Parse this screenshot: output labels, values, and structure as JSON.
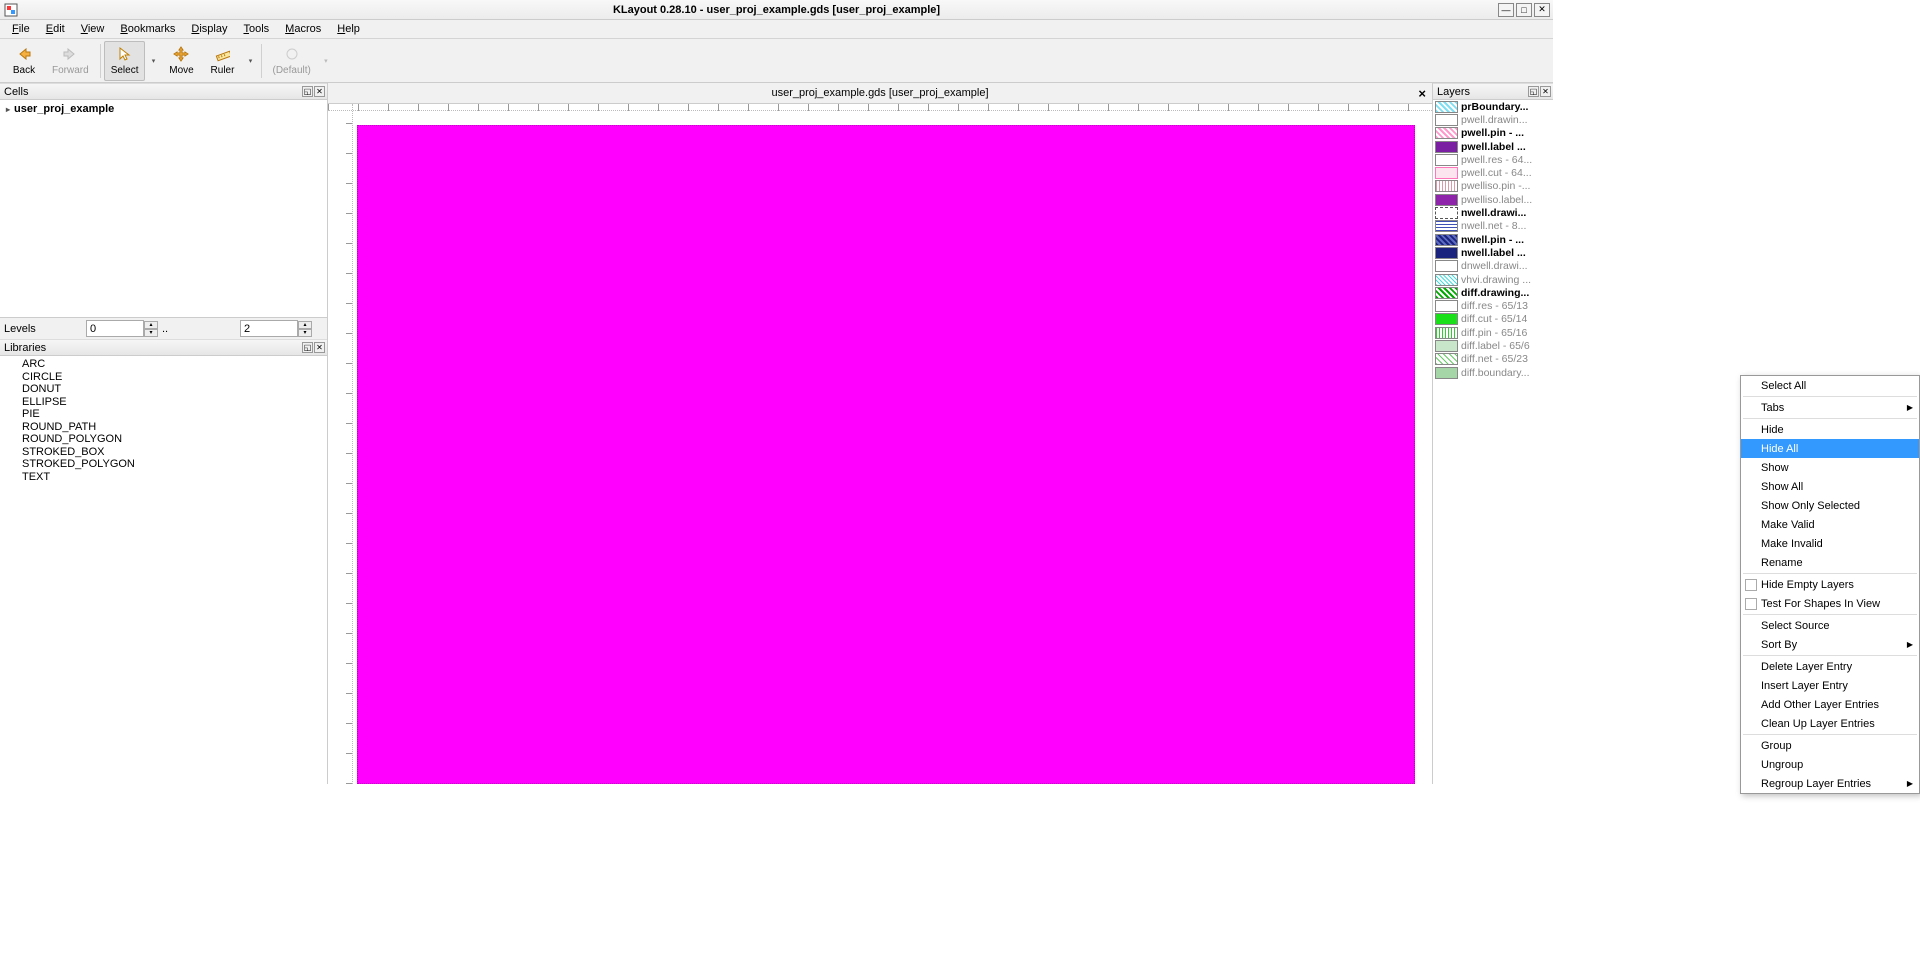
{
  "window": {
    "title": "KLayout 0.28.10 - user_proj_example.gds [user_proj_example]"
  },
  "menu": {
    "file": "File",
    "edit": "Edit",
    "view": "View",
    "bookmarks": "Bookmarks",
    "display": "Display",
    "tools": "Tools",
    "macros": "Macros",
    "help": "Help"
  },
  "toolbar": {
    "back": "Back",
    "forward": "Forward",
    "select": "Select",
    "move": "Move",
    "ruler": "Ruler",
    "default": "(Default)"
  },
  "cells": {
    "title": "Cells",
    "item0": "user_proj_example"
  },
  "levels": {
    "label": "Levels",
    "from": "0",
    "dots": "..",
    "to": "2"
  },
  "libraries": {
    "title": "Libraries",
    "i0": "ARC",
    "i1": "CIRCLE",
    "i2": "DONUT",
    "i3": "ELLIPSE",
    "i4": "PIE",
    "i5": "ROUND_PATH",
    "i6": "ROUND_POLYGON",
    "i7": "STROKED_BOX",
    "i8": "STROKED_POLYGON",
    "i9": "TEXT"
  },
  "canvas": {
    "title": "user_proj_example.gds [user_proj_example]"
  },
  "layers": {
    "title": "Layers",
    "rows": [
      {
        "name": "prBoundary...",
        "bold": true,
        "sw": "background:repeating-linear-gradient(45deg,#7edff2,#7edff2 2px,#fff 2px,#fff 4px);"
      },
      {
        "name": "pwell.drawin...",
        "dim": true,
        "sw": "background:#fff;"
      },
      {
        "name": "pwell.pin - ...",
        "bold": true,
        "sw": "background:repeating-linear-gradient(45deg,#f9c,#f9c 2px,#fff 2px,#fff 4px);"
      },
      {
        "name": "pwell.label ...",
        "bold": true,
        "sw": "background:#7b1fa2;"
      },
      {
        "name": "pwell.res - 64...",
        "dim": true,
        "sw": "background:#fff;"
      },
      {
        "name": "pwell.cut - 64...",
        "dim": true,
        "sw": "background:#fde5f0;border-color:#f7b;"
      },
      {
        "name": "pwelliso.pin -...",
        "dim": true,
        "sw": "background:repeating-linear-gradient(90deg,#d9a,#d9a 1px,#fff 1px,#fff 3px);"
      },
      {
        "name": "pwelliso.label...",
        "dim": true,
        "sw": "background:#8e24aa;"
      },
      {
        "name": "nwell.drawi...",
        "bold": true,
        "sw": "background:#fff;border:1px dashed #555;"
      },
      {
        "name": "nwell.net - 8...",
        "dim": true,
        "sw": "background:repeating-linear-gradient(0deg,#3f51b5,#3f51b5 1px,#fff 1px,#fff 3px);"
      },
      {
        "name": "nwell.pin - ...",
        "bold": true,
        "sw": "background:repeating-linear-gradient(45deg,#1a237e,#1a237e 2px,#5c6bc0 2px,#5c6bc0 4px);"
      },
      {
        "name": "nwell.label ...",
        "bold": true,
        "sw": "background:#1a237e;"
      },
      {
        "name": "dnwell.drawi...",
        "dim": true,
        "sw": "background:#fff;"
      },
      {
        "name": "vhvi.drawing ...",
        "dim": true,
        "sw": "background:repeating-linear-gradient(45deg,#4dd,#4dd 1px,#fff 1px,#fff 3px);"
      },
      {
        "name": "diff.drawing...",
        "bold": true,
        "sw": "background:repeating-linear-gradient(45deg,#0a0,#0a0 2px,#fff 2px,#fff 4px);"
      },
      {
        "name": "diff.res - 65/13",
        "dim": true,
        "sw": "background:#fff;"
      },
      {
        "name": "diff.cut - 65/14",
        "dim": true,
        "sw": "background:#19e019;"
      },
      {
        "name": "diff.pin - 65/16",
        "dim": true,
        "sw": "background:repeating-linear-gradient(90deg,#3c3,#3c3 1px,#fff 1px,#fff 3px);"
      },
      {
        "name": "diff.label - 65/6",
        "dim": true,
        "sw": "background:#c8e6c9;"
      },
      {
        "name": "diff.net - 65/23",
        "dim": true,
        "sw": "background:repeating-linear-gradient(45deg,#6c6,#6c6 1px,#fff 1px,#fff 4px);"
      },
      {
        "name": "diff.boundary...",
        "dim": true,
        "sw": "background:#a5d6a7;"
      }
    ]
  },
  "ctx": {
    "select_all": "Select All",
    "tabs": "Tabs",
    "hide": "Hide",
    "hide_all": "Hide All",
    "show": "Show",
    "show_all": "Show All",
    "show_only": "Show Only Selected",
    "make_valid": "Make Valid",
    "make_invalid": "Make Invalid",
    "rename": "Rename",
    "hide_empty": "Hide Empty Layers",
    "test_shapes": "Test For Shapes In View",
    "select_source": "Select Source",
    "sort_by": "Sort By",
    "delete_entry": "Delete Layer Entry",
    "insert_entry": "Insert Layer Entry",
    "add_other": "Add Other Layer Entries",
    "clean_up": "Clean Up Layer Entries",
    "group": "Group",
    "ungroup": "Ungroup",
    "regroup": "Regroup Layer Entries"
  }
}
